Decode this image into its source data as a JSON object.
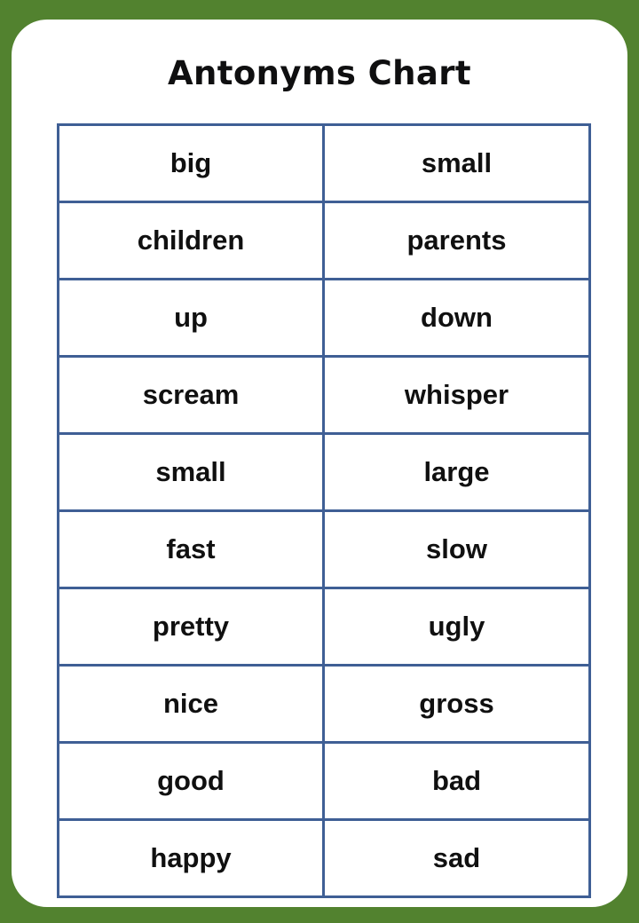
{
  "page": {
    "background_color": "#52822f",
    "card_color": "#ffffff"
  },
  "title": "Antonyms Chart",
  "table": {
    "border_color": "#3f5f95",
    "text_color": "#101010",
    "columns": 2,
    "row_count": 10,
    "rows": [
      {
        "word": "big",
        "antonym": "small"
      },
      {
        "word": "children",
        "antonym": "parents"
      },
      {
        "word": "up",
        "antonym": "down"
      },
      {
        "word": "scream",
        "antonym": "whisper"
      },
      {
        "word": "small",
        "antonym": "large"
      },
      {
        "word": "fast",
        "antonym": "slow"
      },
      {
        "word": "pretty",
        "antonym": "ugly"
      },
      {
        "word": "nice",
        "antonym": "gross"
      },
      {
        "word": "good",
        "antonym": "bad"
      },
      {
        "word": "happy",
        "antonym": "sad"
      }
    ]
  }
}
